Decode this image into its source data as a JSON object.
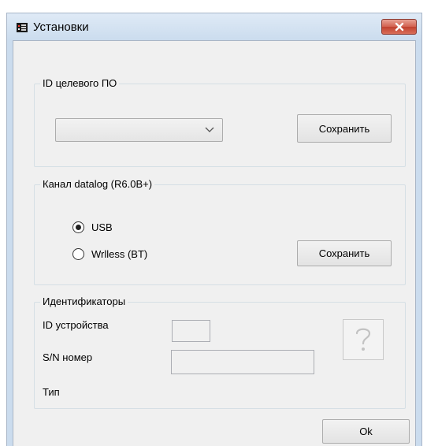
{
  "window": {
    "title": "Установки",
    "close_label": "x"
  },
  "target_fw": {
    "group_label": "ID целевого ПО",
    "selected_value": "",
    "save_label": "Сохранить"
  },
  "datalog": {
    "group_label": "Канал datalog (R6.0B+)",
    "options": [
      {
        "label": "USB",
        "checked": true
      },
      {
        "label": "Wrlless (BT)",
        "checked": false
      }
    ],
    "save_label": "Сохранить"
  },
  "identifiers": {
    "group_label": "Идентификаторы",
    "device_id_label": "ID устройства",
    "device_id_value": "",
    "serial_label": "S/N номер",
    "serial_value": "",
    "type_label": "Тип",
    "type_value": "",
    "help_icon": "question-mark-icon"
  },
  "ok_label": "Ok",
  "colors": {
    "titlebar": "#cbdcee",
    "client_bg": "#f0f0f0",
    "close_button": "#c74a38"
  }
}
